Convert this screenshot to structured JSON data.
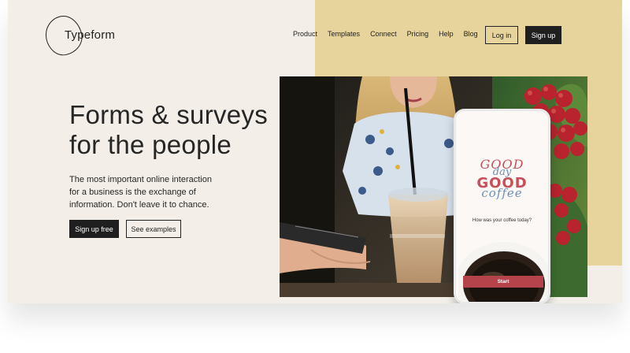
{
  "brand": {
    "logo_text": "Typeform"
  },
  "nav": {
    "items": [
      {
        "label": "Product"
      },
      {
        "label": "Templates"
      },
      {
        "label": "Connect"
      },
      {
        "label": "Pricing"
      },
      {
        "label": "Help"
      },
      {
        "label": "Blog"
      }
    ],
    "login_label": "Log in",
    "signup_label": "Sign up"
  },
  "hero": {
    "headline_line1": "Forms & surveys",
    "headline_line2": "for the people",
    "subtext_line1": "The most important online interaction",
    "subtext_line2": "for a business is the exchange of",
    "subtext_line3": "information. Don't leave it to chance.",
    "cta_primary": "Sign up free",
    "cta_secondary": "See examples"
  },
  "phone": {
    "title_good1": "GOOD",
    "title_day": "day",
    "title_good2": "GOOD",
    "title_coffee": "coffee",
    "question": "How was your coffee today?",
    "start_label": "Start"
  },
  "colors": {
    "background": "#f3efe8",
    "accent_beige": "#e7d39c",
    "button_dark": "#1f1f1f",
    "phone_red": "#c5505a",
    "phone_blue": "#6c8fb8",
    "start_red": "#b5434b"
  }
}
